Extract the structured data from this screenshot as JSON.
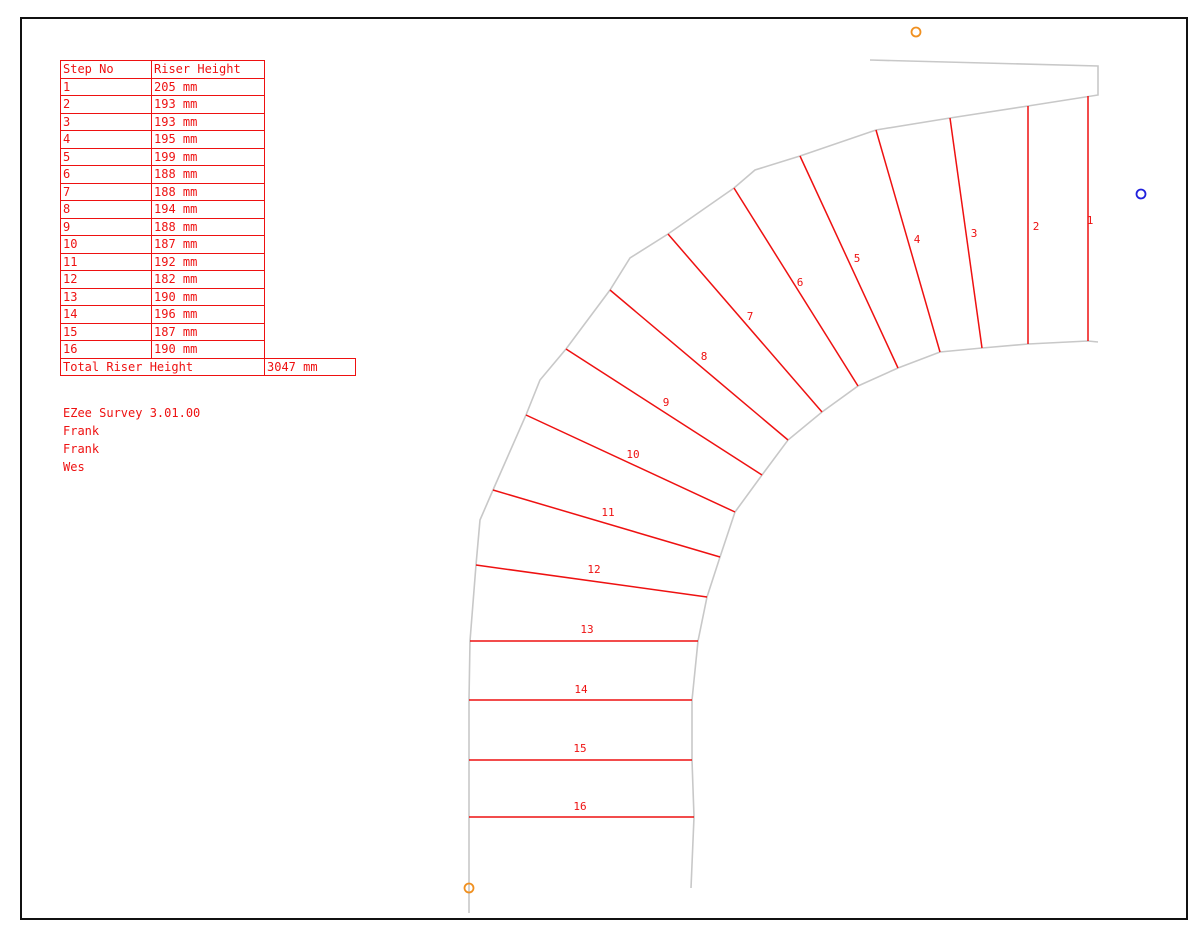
{
  "riser_table": {
    "headers": [
      "Step No",
      "Riser Height"
    ],
    "rows": [
      [
        "1",
        "205 mm"
      ],
      [
        "2",
        "193 mm"
      ],
      [
        "3",
        "193 mm"
      ],
      [
        "4",
        "195 mm"
      ],
      [
        "5",
        "199 mm"
      ],
      [
        "6",
        "188 mm"
      ],
      [
        "7",
        "188 mm"
      ],
      [
        "8",
        "194 mm"
      ],
      [
        "9",
        "188 mm"
      ],
      [
        "10",
        "187 mm"
      ],
      [
        "11",
        "192 mm"
      ],
      [
        "12",
        "182 mm"
      ],
      [
        "13",
        "190 mm"
      ],
      [
        "14",
        "196 mm"
      ],
      [
        "15",
        "187 mm"
      ],
      [
        "16",
        "190 mm"
      ]
    ],
    "total_label": "Total Riser Height",
    "total_value": "3047 mm"
  },
  "notes": {
    "software": "EZee Survey 3.01.00",
    "line1": "Frank",
    "line2": "Frank",
    "line3": "Wes"
  },
  "colors": {
    "tread_line": "#ee1111",
    "outline": "#c8c8c8",
    "marker_orange": "#f09020",
    "marker_blue": "#2020dd",
    "frame": "#111111"
  },
  "steps": [
    "1",
    "2",
    "3",
    "4",
    "5",
    "6",
    "7",
    "8",
    "9",
    "10",
    "11",
    "12",
    "13",
    "14",
    "15",
    "16"
  ],
  "markers": [
    "start-point",
    "end-point",
    "reference-point"
  ]
}
